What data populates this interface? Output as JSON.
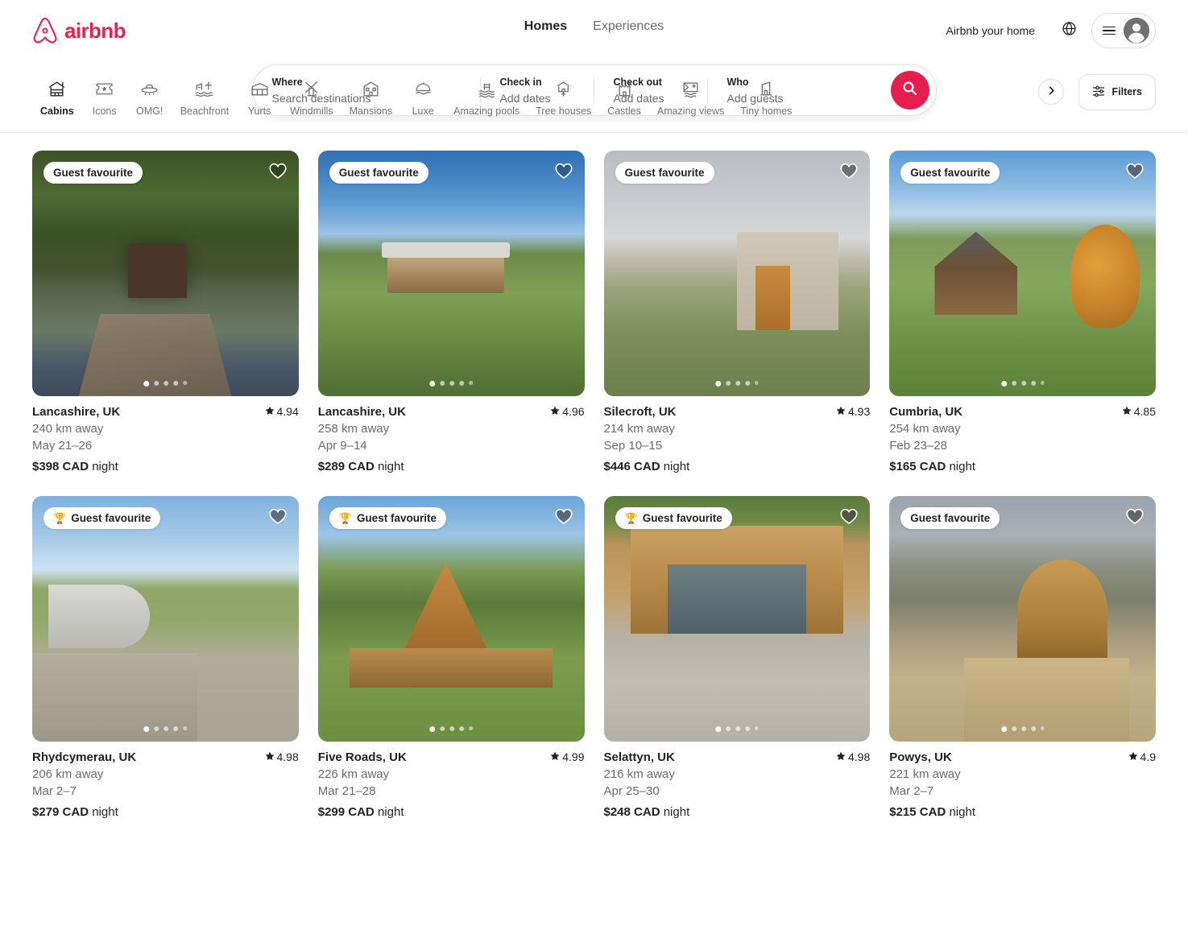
{
  "header": {
    "brand": "airbnb",
    "nav": [
      {
        "label": "Homes",
        "active": true
      },
      {
        "label": "Experiences",
        "active": false
      }
    ],
    "host_link": "Airbnb your home",
    "globe_icon": "globe-icon",
    "menu_icon": "hamburger-icon",
    "avatar_icon": "user-avatar-icon"
  },
  "search": {
    "where_label": "Where",
    "where_placeholder": "Search destinations",
    "checkin_label": "Check in",
    "checkin_value": "Add dates",
    "checkout_label": "Check out",
    "checkout_value": "Add dates",
    "who_label": "Who",
    "who_value": "Add guests",
    "search_icon": "search-icon",
    "accent_color": "#E61E4D"
  },
  "categories": {
    "items": [
      {
        "label": "Cabins",
        "icon": "cabin-icon",
        "active": true
      },
      {
        "label": "Icons",
        "icon": "ticket-star-icon",
        "active": false
      },
      {
        "label": "OMG!",
        "icon": "ufo-icon",
        "active": false
      },
      {
        "label": "Beachfront",
        "icon": "beach-palm-icon",
        "active": false
      },
      {
        "label": "Yurts",
        "icon": "yurt-icon",
        "active": false
      },
      {
        "label": "Windmills",
        "icon": "windmill-icon",
        "active": false
      },
      {
        "label": "Mansions",
        "icon": "mansion-icon",
        "active": false
      },
      {
        "label": "Luxe",
        "icon": "cloche-icon",
        "active": false
      },
      {
        "label": "Amazing pools",
        "icon": "pool-icon",
        "active": false
      },
      {
        "label": "Tree houses",
        "icon": "treehouse-icon",
        "active": false
      },
      {
        "label": "Castles",
        "icon": "castle-icon",
        "active": false
      },
      {
        "label": "Amazing views",
        "icon": "view-frame-icon",
        "active": false
      },
      {
        "label": "Tiny homes",
        "icon": "tiny-home-icon",
        "active": false
      }
    ],
    "next_icon": "chevron-right-icon",
    "filters_label": "Filters",
    "filters_icon": "sliders-icon"
  },
  "listings": [
    {
      "badge": "Guest favourite",
      "badge_trophy": false,
      "title": "Lancashire, UK",
      "distance": "240 km away",
      "dates": "May 21–26",
      "price_amount": "$398 CAD",
      "price_unit": "night",
      "rating": "4.94",
      "photos": 5,
      "active_photo": 0,
      "heart_icon": "heart-outline-icon",
      "photo_class": "ph1"
    },
    {
      "badge": "Guest favourite",
      "badge_trophy": false,
      "title": "Lancashire, UK",
      "distance": "258 km away",
      "dates": "Apr 9–14",
      "price_amount": "$289 CAD",
      "price_unit": "night",
      "rating": "4.96",
      "photos": 5,
      "active_photo": 0,
      "heart_icon": "heart-outline-icon",
      "photo_class": "ph2"
    },
    {
      "badge": "Guest favourite",
      "badge_trophy": false,
      "title": "Silecroft, UK",
      "distance": "214 km away",
      "dates": "Sep 10–15",
      "price_amount": "$446 CAD",
      "price_unit": "night",
      "rating": "4.93",
      "photos": 5,
      "active_photo": 0,
      "heart_icon": "heart-filled-icon",
      "photo_class": "ph3"
    },
    {
      "badge": "Guest favourite",
      "badge_trophy": false,
      "title": "Cumbria, UK",
      "distance": "254 km away",
      "dates": "Feb 23–28",
      "price_amount": "$165 CAD",
      "price_unit": "night",
      "rating": "4.85",
      "photos": 5,
      "active_photo": 0,
      "heart_icon": "heart-filled-icon",
      "photo_class": "ph4"
    },
    {
      "badge": "Guest favourite",
      "badge_trophy": true,
      "title": "Rhydcymerau, UK",
      "distance": "206 km away",
      "dates": "Mar 2–7",
      "price_amount": "$279 CAD",
      "price_unit": "night",
      "rating": "4.98",
      "photos": 5,
      "active_photo": 0,
      "heart_icon": "heart-filled-icon",
      "photo_class": "ph5"
    },
    {
      "badge": "Guest favourite",
      "badge_trophy": true,
      "title": "Five Roads, UK",
      "distance": "226 km away",
      "dates": "Mar 21–28",
      "price_amount": "$299 CAD",
      "price_unit": "night",
      "rating": "4.99",
      "photos": 5,
      "active_photo": 0,
      "heart_icon": "heart-filled-icon",
      "photo_class": "ph6"
    },
    {
      "badge": "Guest favourite",
      "badge_trophy": true,
      "title": "Selattyn, UK",
      "distance": "216 km away",
      "dates": "Apr 25–30",
      "price_amount": "$248 CAD",
      "price_unit": "night",
      "rating": "4.98",
      "photos": 5,
      "active_photo": 0,
      "heart_icon": "heart-filled-icon",
      "photo_class": "ph7"
    },
    {
      "badge": "Guest favourite",
      "badge_trophy": false,
      "title": "Powys, UK",
      "distance": "221 km away",
      "dates": "Mar 2–7",
      "price_amount": "$215 CAD",
      "price_unit": "night",
      "rating": "4.9",
      "photos": 5,
      "active_photo": 0,
      "heart_icon": "heart-filled-icon",
      "photo_class": "ph8"
    }
  ]
}
